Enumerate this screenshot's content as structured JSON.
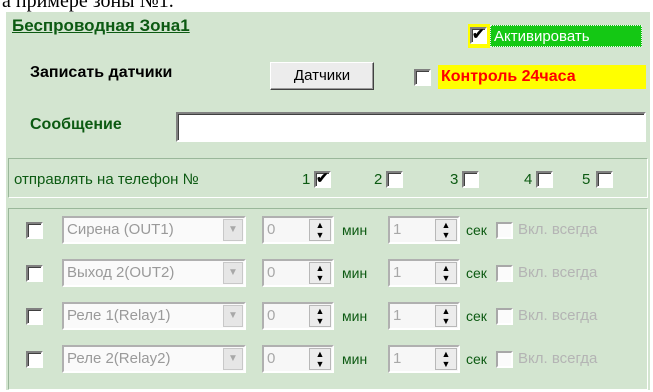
{
  "top_text": "а примере зоны №1.",
  "panel": {
    "title": "Беспроводная Зона1",
    "activate": {
      "label": "Активировать",
      "checked": true
    },
    "sensors": {
      "label": "Записать датчики",
      "button": "Датчики"
    },
    "control24": {
      "label": "Контроль 24часа",
      "checked": false
    },
    "message": {
      "label": "Сообщение",
      "value": ""
    },
    "phones": {
      "label": "отправлять на телефон №",
      "items": [
        {
          "num": "1",
          "checked": true
        },
        {
          "num": "2",
          "checked": false
        },
        {
          "num": "3",
          "checked": false
        },
        {
          "num": "4",
          "checked": false
        },
        {
          "num": "5",
          "checked": false
        }
      ]
    },
    "outputs": [
      {
        "name": "Сирена (OUT1)",
        "min": "0",
        "sec": "1",
        "always": "Вкл. всегда"
      },
      {
        "name": "Выход 2(OUT2)",
        "min": "0",
        "sec": "1",
        "always": "Вкл. всегда"
      },
      {
        "name": "Реле 1(Relay1)",
        "min": "0",
        "sec": "1",
        "always": "Вкл. всегда"
      },
      {
        "name": "Реле 2(Relay2)",
        "min": "0",
        "sec": "1",
        "always": "Вкл. всегда"
      }
    ],
    "units": {
      "min": "мин",
      "sec": "сек"
    },
    "colors": {
      "panel_bg": "#d3e5d0",
      "title": "#0c5a12",
      "activate_bg": "#14c814",
      "highlight": "#ffff00",
      "alert_text": "#ff0000"
    }
  }
}
